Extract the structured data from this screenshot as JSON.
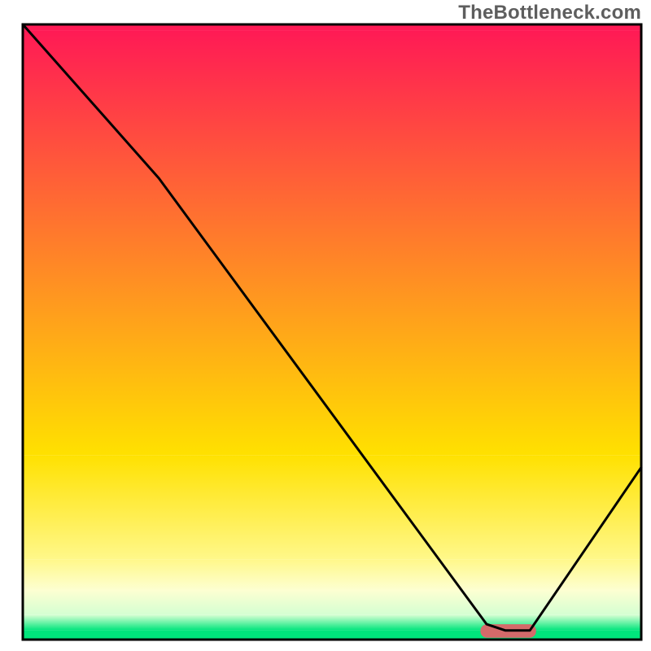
{
  "watermark": {
    "text": "TheBottleneck.com"
  },
  "chart_data": {
    "type": "line",
    "title": "",
    "xlabel": "",
    "ylabel": "",
    "xlim": [
      0,
      100
    ],
    "ylim": [
      0,
      100
    ],
    "background_bands": [
      {
        "y0": 99,
        "y1": 100,
        "color0": "#ff1a55",
        "color1": "#ff1a55"
      },
      {
        "y0": 30,
        "y1": 99,
        "color0": "#ffe100",
        "color1": "#ff1a55"
      },
      {
        "y0": 13,
        "y1": 30,
        "color0": "#fff88a",
        "color1": "#ffe100"
      },
      {
        "y0": 8,
        "y1": 13,
        "color0": "#fdffd2",
        "color1": "#fff88a"
      },
      {
        "y0": 4,
        "y1": 8,
        "color0": "#d4ffd2",
        "color1": "#fdffd2"
      },
      {
        "y0": 1.5,
        "y1": 4,
        "color0": "#00e57c",
        "color1": "#d4ffd2"
      },
      {
        "y0": 0,
        "y1": 1.5,
        "color0": "#00e57c",
        "color1": "#00e57c"
      }
    ],
    "series": [
      {
        "name": "curve",
        "color": "#000000",
        "x": [
          0,
          22,
          75,
          78,
          82,
          100
        ],
        "y": [
          100,
          75,
          2.5,
          1.5,
          1.5,
          28
        ]
      }
    ],
    "marker": {
      "name": "highlight-pill",
      "color": "#d46a6a",
      "x0": 74,
      "x1": 83,
      "y": 1.4,
      "thickness": 2.2
    },
    "frame": {
      "color": "#000000",
      "width": 3
    }
  }
}
